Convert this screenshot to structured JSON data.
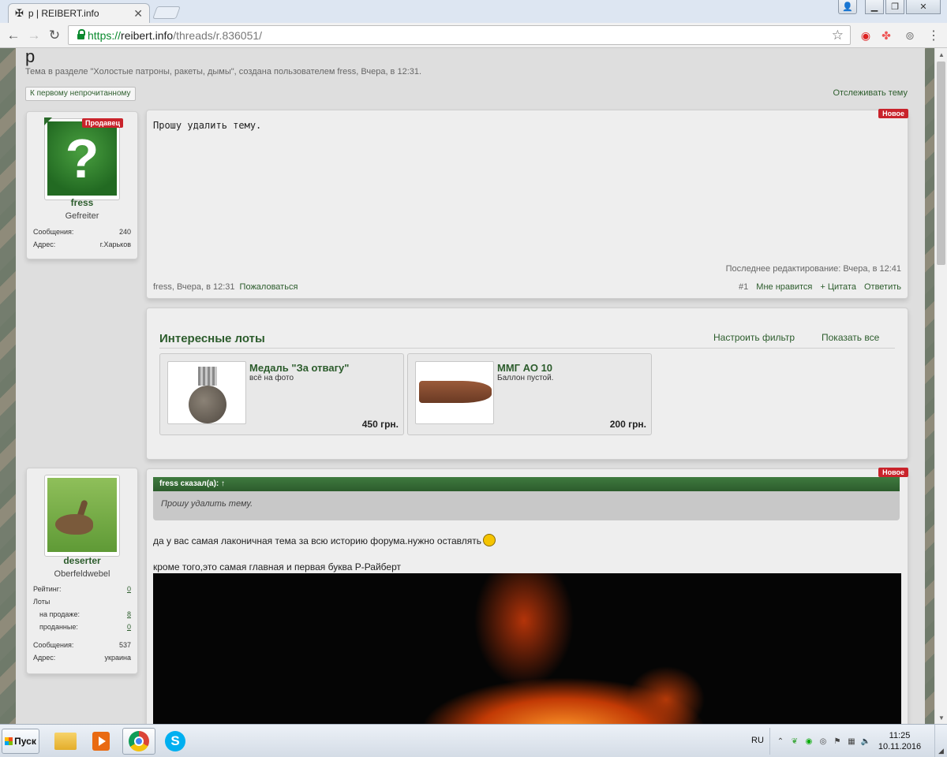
{
  "browser": {
    "tab_title": "р | REIBERT.info",
    "tab_icon": "iron-cross-icon",
    "url_scheme": "https://",
    "url_host": "reibert.info",
    "url_path": "/threads/r.836051/",
    "window_buttons": [
      "user-icon",
      "minimize-icon",
      "restore-icon",
      "close-icon"
    ]
  },
  "thread": {
    "title": "р",
    "description": "Тема в разделе \"Холостые патроны, ракеты, дымы\", создана пользователем fress, Вчера, в 12:31.",
    "first_unread_button": "К первому непрочитанному",
    "watch_link": "Отслеживать тему"
  },
  "post1": {
    "seller_ribbon": "Продавец",
    "username": "fress",
    "user_title": "Gefreiter",
    "stats": [
      {
        "label": "Сообщения:",
        "value": "240"
      },
      {
        "label": "Адрес:",
        "value": "г.Харьков"
      }
    ],
    "new_badge": "Новое",
    "message": "Прошу удалить тему.",
    "last_edit": "Последнее редактирование: Вчера, в 12:41",
    "author_time": "fress, Вчера, в 12:31",
    "report_link": "Пожаловаться",
    "post_number": "#1",
    "like_link": "Мне нравится",
    "quote_link": "+ Цитата",
    "reply_link": "Ответить"
  },
  "lots": {
    "title": "Интересные лоты",
    "filter_link": "Настроить фильтр",
    "show_all_link": "Показать все",
    "items": [
      {
        "name": "Медаль \"За отвагу\"",
        "desc": "всё на фото",
        "price": "450 грн."
      },
      {
        "name": "ММГ АО 10",
        "desc": "Баллон пустой.",
        "price": "200 грн."
      }
    ]
  },
  "post2": {
    "username": "deserter",
    "user_title": "Oberfeldwebel",
    "rating_label": "Рейтинг:",
    "rating_value": "0",
    "lots_label": "Лоты",
    "on_sale_label": "на продаже:",
    "on_sale_value": "8",
    "sold_label": "проданные:",
    "sold_value": "0",
    "messages_label": "Сообщения:",
    "messages_value": "537",
    "address_label": "Адрес:",
    "address_value": "украина",
    "new_badge": "Новое",
    "quote_header": "fress сказал(а): ↑",
    "quote_text": "Прошу удалить тему.",
    "line1": "да у вас самая лаконичная тема за всю историю форума.нужно оставлять",
    "line2": "кроме того,это самая главная и первая буква Р-Райберт"
  },
  "taskbar": {
    "start_label": "Пуск",
    "apps": [
      "folder-icon",
      "media-player-icon",
      "chrome-icon",
      "skype-icon"
    ],
    "skype_glyph": "S",
    "language": "RU",
    "time": "11:25",
    "date": "10.11.2016"
  },
  "colors": {
    "accent_green": "#2c5c2c",
    "badge_red": "#c9232b"
  }
}
